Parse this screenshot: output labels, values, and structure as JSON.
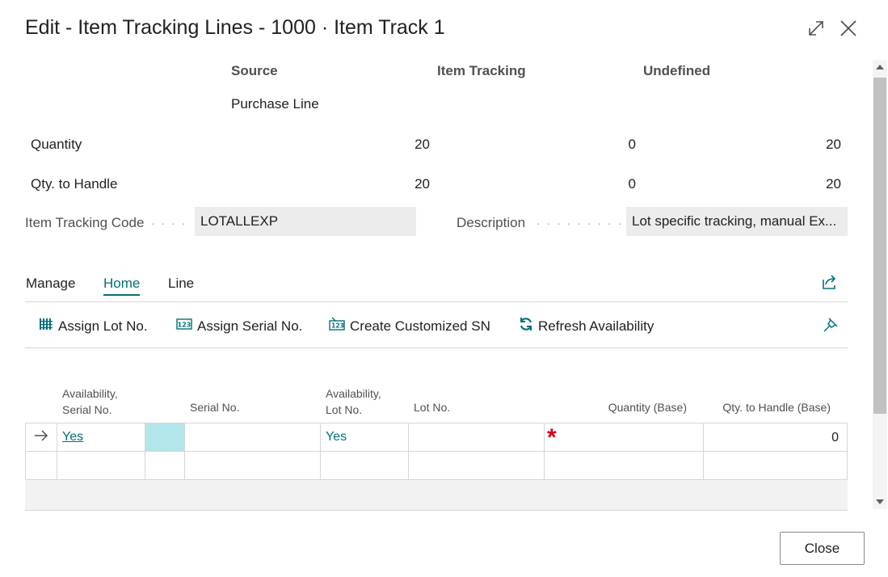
{
  "dialog": {
    "title": "Edit - Item Tracking Lines - 1000 · Item Track 1"
  },
  "summary": {
    "columns": [
      "Source",
      "Item Tracking",
      "Undefined"
    ],
    "source_type": "Purchase Line",
    "rows": [
      {
        "label": "Quantity",
        "values": [
          "20",
          "0",
          "20"
        ]
      },
      {
        "label": "Qty. to Handle",
        "values": [
          "20",
          "0",
          "20"
        ]
      }
    ]
  },
  "fields": {
    "item_tracking_code": {
      "label": "Item Tracking Code",
      "value": "LOTALLEXP"
    },
    "description": {
      "label": "Description",
      "value": "Lot specific tracking, manual Ex..."
    }
  },
  "tabs": [
    {
      "label": "Manage",
      "active": false
    },
    {
      "label": "Home",
      "active": true
    },
    {
      "label": "Line",
      "active": false
    }
  ],
  "actions": [
    {
      "label": "Assign Lot No.",
      "icon": "grid-icon"
    },
    {
      "label": "Assign Serial No.",
      "icon": "number-123-icon"
    },
    {
      "label": "Create Customized SN",
      "icon": "custom-number-icon"
    },
    {
      "label": "Refresh Availability",
      "icon": "refresh-icon"
    }
  ],
  "grid": {
    "headers": {
      "availability_serial_1": "Availability,",
      "availability_serial_2": "Serial No.",
      "serial_no": "Serial No.",
      "availability_lot_1": "Availability,",
      "availability_lot_2": "Lot No.",
      "lot_no": "Lot No.",
      "quantity_base": "Quantity (Base)",
      "qty_to_handle_base": "Qty. to Handle (Base)"
    },
    "rows": [
      {
        "availability_serial": "Yes",
        "serial_no": "",
        "availability_lot": "Yes",
        "lot_no": "",
        "quantity_base": "",
        "qty_to_handle_base": "0",
        "required_mark": "*"
      }
    ]
  },
  "footer": {
    "close_label": "Close"
  },
  "colors": {
    "accent": "#00707a",
    "selected_cell": "#b2e6ea",
    "required": "#d0021b"
  }
}
